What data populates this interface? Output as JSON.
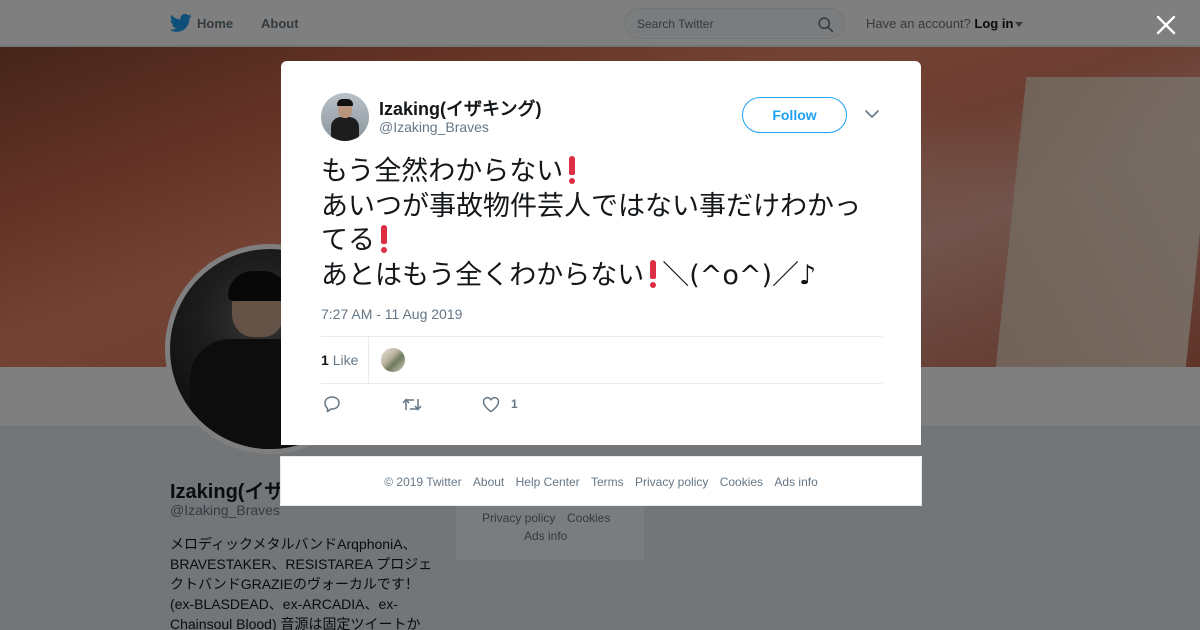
{
  "topbar": {
    "home_label": "Home",
    "about_label": "About",
    "search_placeholder": "Search Twitter",
    "have_account": "Have an account?",
    "login_label": "Log in"
  },
  "profile": {
    "name": "Izaking(イザ",
    "handle": "@Izaking_Braves",
    "bio": "メロディックメタルバンドArqphoniA、BRAVESTAKER、RESISTAREA プロジェクトバンドGRAZIEのヴォーカルです！ (ex-BLASDEAD、ex-ARCADIA、ex-Chainsoul Blood) 音源は固定ツイートか"
  },
  "side_footer": {
    "privacy": "Privacy policy",
    "cookies": "Cookies",
    "ads": "Ads info"
  },
  "tweet": {
    "author_name": "Izaking(イザキング)",
    "author_handle": "@Izaking_Braves",
    "follow_label": "Follow",
    "lines": [
      "もう全然わからない",
      "あいつが事故物件芸人ではない事だけわかっ",
      "てる",
      "あとはもう全くわからない",
      "＼(^o^)／♪"
    ],
    "emoji": "heavy-exclamation-mark",
    "timestamp": "7:27 AM - 11 Aug 2019",
    "like_count": "1",
    "like_label": "Like",
    "action_like_count": "1"
  },
  "footer": {
    "copyright": "© 2019 Twitter",
    "links": [
      "About",
      "Help Center",
      "Terms",
      "Privacy policy",
      "Cookies",
      "Ads info"
    ]
  },
  "colors": {
    "brand": "#1da1f2",
    "text": "#14171a",
    "muted": "#657786",
    "exclamation": "#dd2e44"
  }
}
